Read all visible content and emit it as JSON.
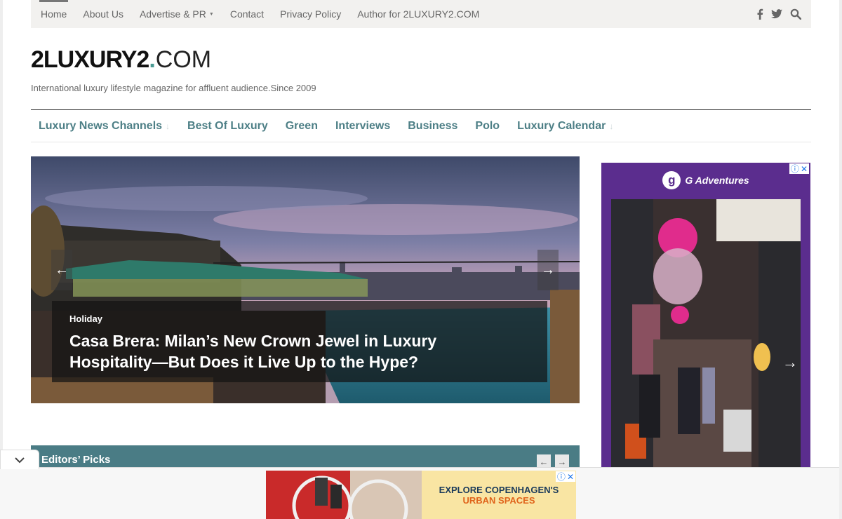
{
  "topbar": {
    "links": [
      "Home",
      "About Us",
      "Advertise & PR",
      "Contact",
      "Privacy Policy",
      "Author for 2LUXURY2.COM"
    ],
    "social_icons": [
      "facebook-icon",
      "twitter-icon",
      "search-icon"
    ]
  },
  "logo": {
    "bold": "2LUXURY2",
    "dot": ".",
    "light": "COM"
  },
  "tagline": "International luxury lifestyle magazine for affluent audience.Since 2009",
  "main_nav": {
    "items": [
      "Luxury News Channels",
      "Best Of Luxury",
      "Green",
      "Interviews",
      "Business",
      "Polo",
      "Luxury Calendar"
    ]
  },
  "slider": {
    "category": "Holiday",
    "title": "Casa Brera: Milan’s New Crown Jewel in Luxury Hospitality—But Does it Live Up to the Hype?",
    "prev_icon": "←",
    "next_icon": "→"
  },
  "sidebar_ad": {
    "brand": "G Adventures",
    "badge": "g",
    "next_icon": "→"
  },
  "editors_picks": {
    "label": "Editors’ Picks",
    "prev": "←",
    "next": "→"
  },
  "bottom_ad": {
    "line1": "EXPLORE COPENHAGEN'S",
    "line2": "URBAN SPACES"
  },
  "colors": {
    "accent": "#4d7f86",
    "picks_bar": "#4a7c85",
    "ad_purple": "#5b2d8e"
  }
}
